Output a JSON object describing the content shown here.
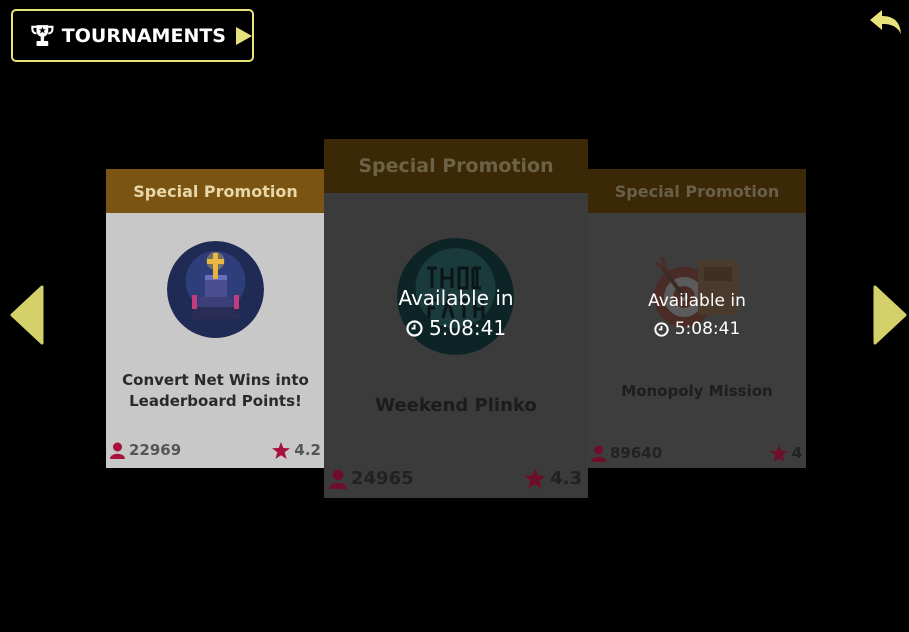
{
  "header": {
    "tournaments_label": "TOURNAMENTS"
  },
  "colors": {
    "accent": "#e8e27a",
    "promo_header": "#7a5410",
    "icon_red": "#a8123c"
  },
  "cards": [
    {
      "header": "Special Promotion",
      "title_line1": "Convert Net Wins into",
      "title_line2": "Leaderboard Points!",
      "players": "22969",
      "rating": "4.2",
      "image_icon": "altar-icon"
    },
    {
      "header": "Special Promotion",
      "title": "Weekend Plinko",
      "players": "24965",
      "rating": "4.3",
      "available_label": "Available in",
      "timer": "5:08:41",
      "image_icon": "ghost-father-icon"
    },
    {
      "header": "Special Promotion",
      "title": "Monopoly Mission",
      "players": "89640",
      "rating": "4",
      "available_label": "Available in",
      "timer": "5:08:41",
      "image_icon": "target-icon"
    }
  ]
}
